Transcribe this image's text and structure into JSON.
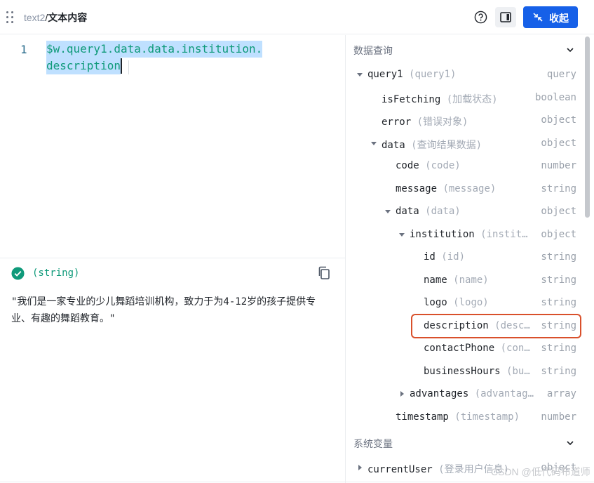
{
  "header": {
    "breadcrumb_parent": "text2",
    "breadcrumb_sep": "/",
    "breadcrumb_current": "文本内容",
    "collapse_label": "收起"
  },
  "editor": {
    "line_number": "1",
    "code_line_1": "$w.query1.data.data.institution.",
    "code_line_2": "description"
  },
  "result": {
    "type_label": "(string)",
    "text": "\"我们是一家专业的少儿舞蹈培训机构，致力于为4-12岁的孩子提供专业、有趣的舞蹈教育。\""
  },
  "data_query": {
    "title": "数据查询",
    "rows": [
      {
        "name": "query1",
        "alias": "(query1)",
        "type": "query"
      },
      {
        "name": "isFetching",
        "alias": "(加载状态)",
        "type": "boolean"
      },
      {
        "name": "error",
        "alias": "(错误对象)",
        "type": "object"
      },
      {
        "name": "data",
        "alias": "(查询结果数据)",
        "type": "object"
      },
      {
        "name": "code",
        "alias": "(code)",
        "type": "number"
      },
      {
        "name": "message",
        "alias": "(message)",
        "type": "string"
      },
      {
        "name": "data",
        "alias": "(data)",
        "type": "object"
      },
      {
        "name": "institution",
        "alias": "(instit…",
        "type": "object"
      },
      {
        "name": "id",
        "alias": "(id)",
        "type": "string"
      },
      {
        "name": "name",
        "alias": "(name)",
        "type": "string"
      },
      {
        "name": "logo",
        "alias": "(logo)",
        "type": "string"
      },
      {
        "name": "description",
        "alias": "(desc…",
        "type": "string"
      },
      {
        "name": "contactPhone",
        "alias": "(con…",
        "type": "string"
      },
      {
        "name": "businessHours",
        "alias": "(bu…",
        "type": "string"
      },
      {
        "name": "advantages",
        "alias": "(advantag…",
        "type": "array"
      },
      {
        "name": "timestamp",
        "alias": "(timestamp)",
        "type": "number"
      }
    ]
  },
  "system_vars": {
    "title": "系统变量",
    "rows": [
      {
        "name": "currentUser",
        "alias": "(登录用户信息)",
        "type": "object"
      }
    ]
  },
  "watermark": "CSDN @低代码布道师",
  "colors": {
    "primary": "#1660e8",
    "success": "#0f9a7a",
    "highlight_border": "#d9502b"
  }
}
